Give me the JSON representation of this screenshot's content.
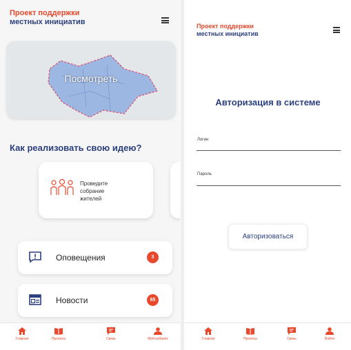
{
  "colors": {
    "accent": "#e8492d",
    "brand_blue": "#2b3f7e",
    "map_fill": "#9db7e3"
  },
  "left": {
    "brand": {
      "line1": "Проект поддержки",
      "line2": "местных инициатив"
    },
    "menu_icon": "hamburger-icon",
    "map": {
      "cta": "Посмотреть"
    },
    "heading": "Как реализовать свою идею?",
    "step": {
      "icon": "people-icon",
      "lines": [
        "Проведите",
        "собрание",
        "жителей"
      ]
    },
    "alerts": {
      "icon": "alert-icon",
      "label": "Оповещения",
      "count": "3"
    },
    "news": {
      "icon": "news-icon",
      "label": "Новости",
      "count": "65"
    },
    "nav": [
      {
        "icon": "home-icon",
        "label": "Главная"
      },
      {
        "icon": "book-icon",
        "label": "Проекты"
      },
      {
        "icon": "chat-icon",
        "label": "Связь"
      },
      {
        "icon": "user-icon",
        "label": "Мой кабинет"
      }
    ]
  },
  "right": {
    "brand": {
      "line1": "Проект поддержки",
      "line2": "местных инициатив"
    },
    "menu_icon": "hamburger-icon",
    "title": "Авторизация в системе",
    "login_label": "Логин",
    "password_label": "Пароль",
    "login_value": "",
    "password_value": "",
    "submit": "Авторизоваться",
    "nav": [
      {
        "icon": "home-icon",
        "label": "Главная"
      },
      {
        "icon": "book-icon",
        "label": "Проекты"
      },
      {
        "icon": "chat-icon",
        "label": "Связь"
      },
      {
        "icon": "user-icon",
        "label": "Войти"
      }
    ]
  }
}
